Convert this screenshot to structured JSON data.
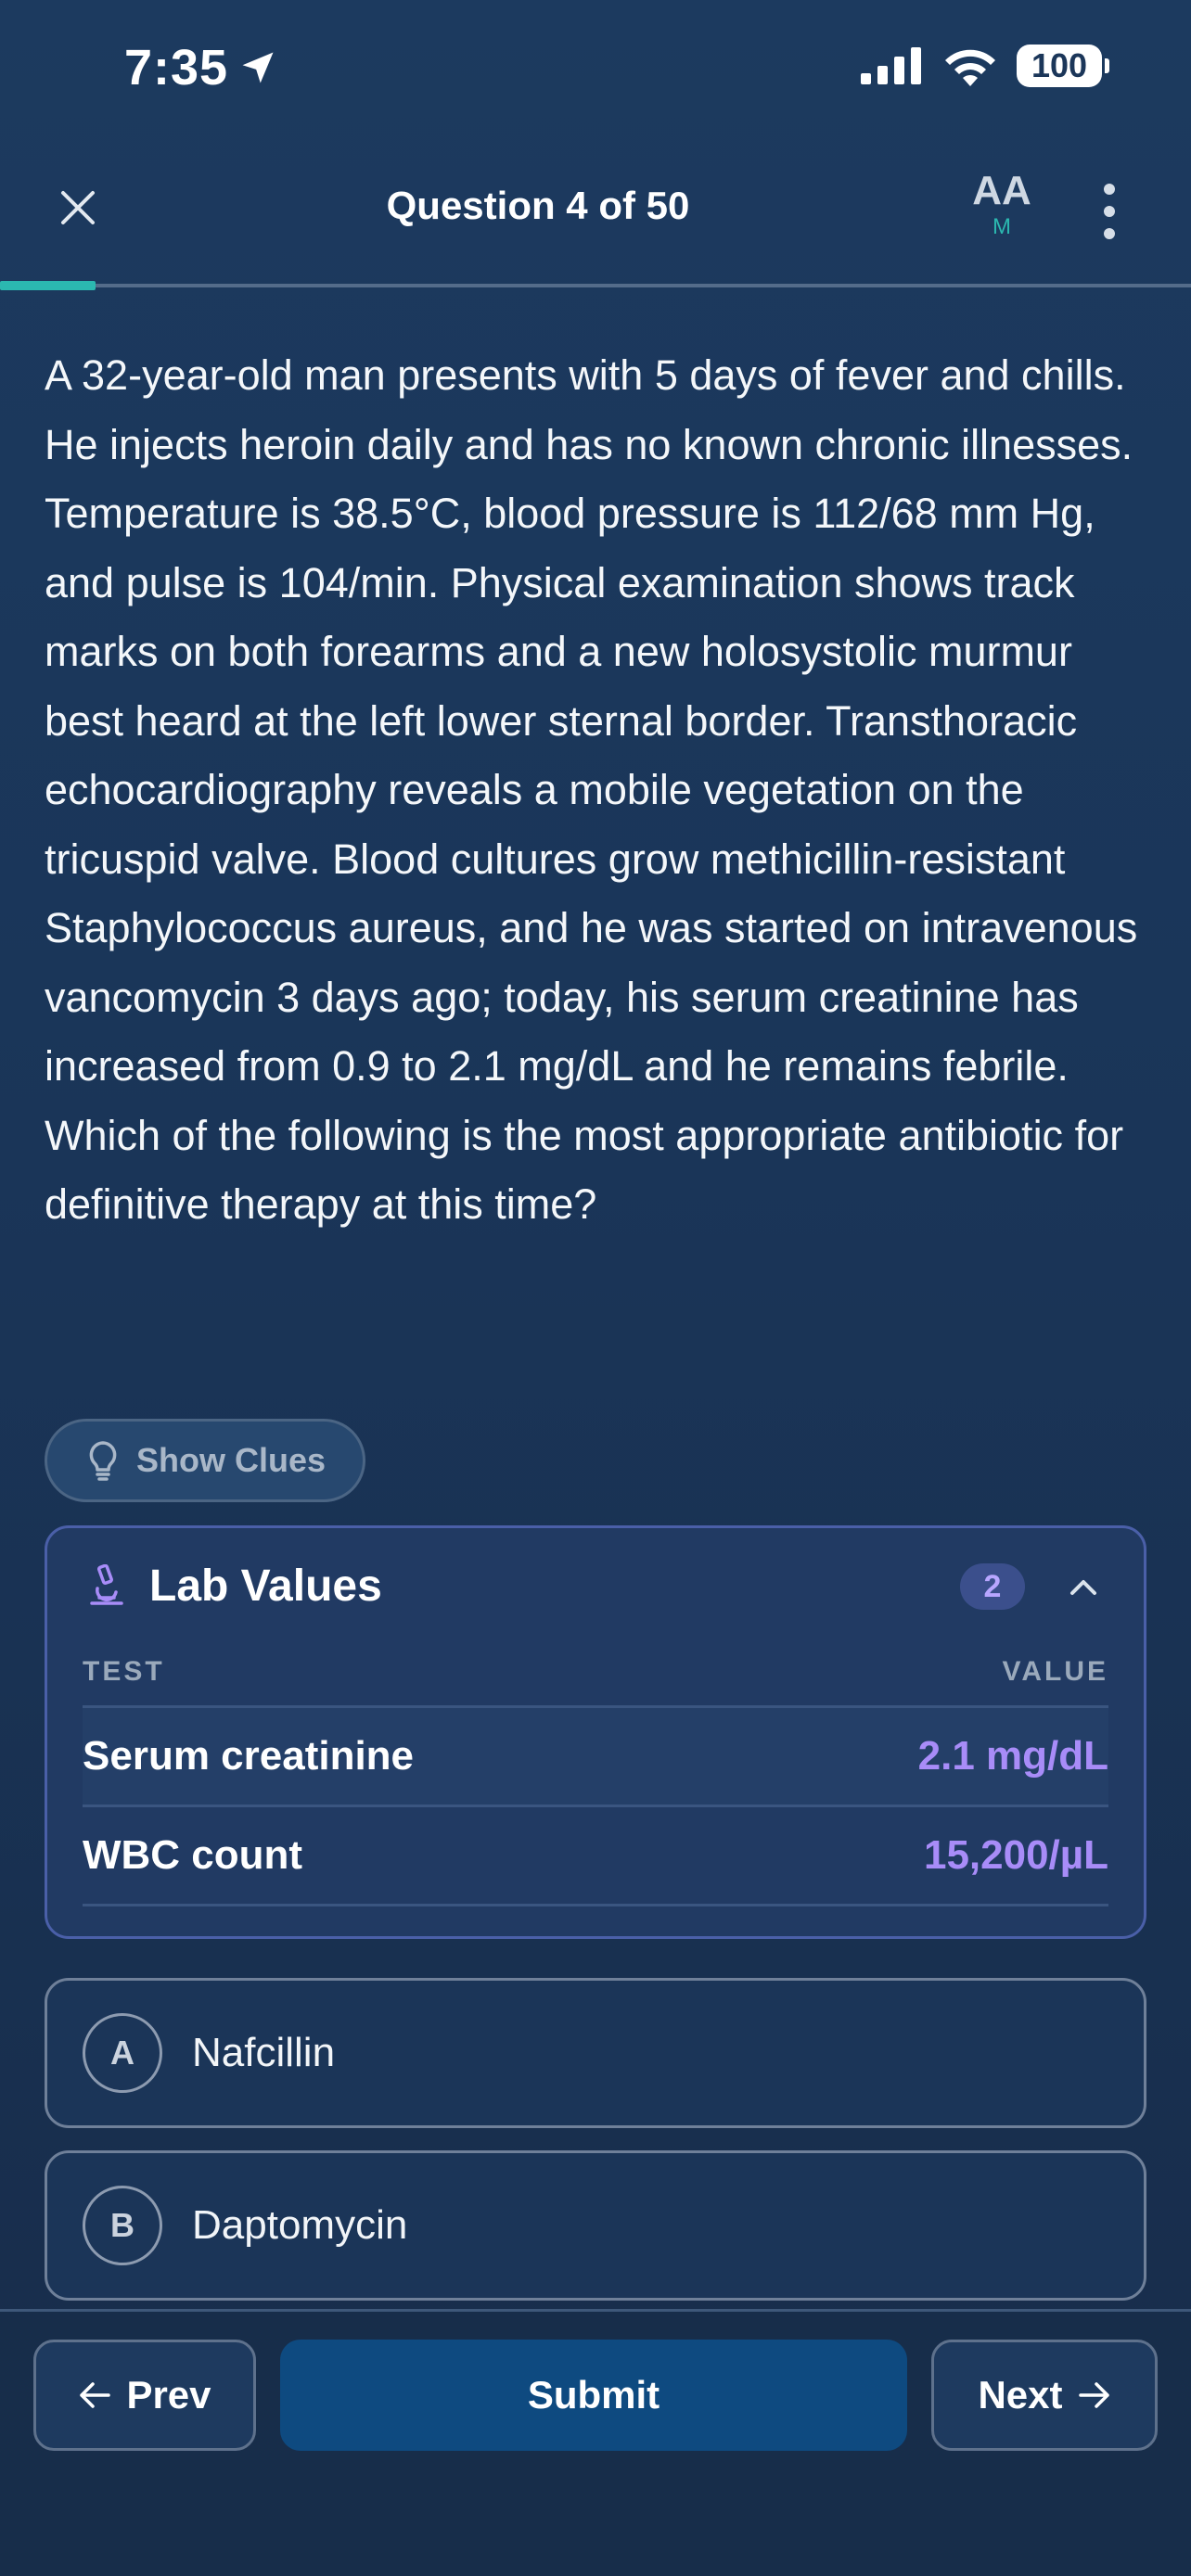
{
  "status_bar": {
    "time": "7:35",
    "battery": "100",
    "icons": [
      "location-arrow-icon",
      "signal-icon",
      "wifi-icon",
      "battery-icon"
    ]
  },
  "header": {
    "title": "Question 4 of 50",
    "font_size_label": "AA",
    "font_size_value": "M",
    "progress_fraction": 0.08
  },
  "question": {
    "text": "A 32-year-old man presents with 5 days of fever and chills. He injects heroin daily and has no known chronic illnesses. Temperature is 38.5°C, blood pressure is 112/68 mm Hg, and pulse is 104/min. Physical examination shows track marks on both forearms and a new holosystolic murmur best heard at the left lower sternal border. Transthoracic echocardiography reveals a mobile vegetation on the tricuspid valve. Blood cultures grow methicillin-resistant Staphylococcus aureus, and he was started on intravenous vancomycin 3 days ago; today, his serum creatinine has increased from 0.9 to 2.1 mg/dL and he remains febrile. Which of the following is the most appropriate antibiotic for definitive therapy at this time?"
  },
  "clues": {
    "label": "Show Clues"
  },
  "lab_values": {
    "title": "Lab Values",
    "count": "2",
    "col_test": "TEST",
    "col_value": "VALUE",
    "rows": [
      {
        "test": "Serum creatinine",
        "value": "2.1 mg/dL"
      },
      {
        "test": "WBC count",
        "value": "15,200/µL"
      }
    ]
  },
  "options": [
    {
      "letter": "A",
      "text": "Nafcillin"
    },
    {
      "letter": "B",
      "text": "Daptomycin"
    }
  ],
  "nav": {
    "prev": "Prev",
    "submit": "Submit",
    "next": "Next"
  },
  "colors": {
    "accent": "#2bb8b0",
    "lab_value": "#a88cf8",
    "submit": "#0e4a80"
  }
}
